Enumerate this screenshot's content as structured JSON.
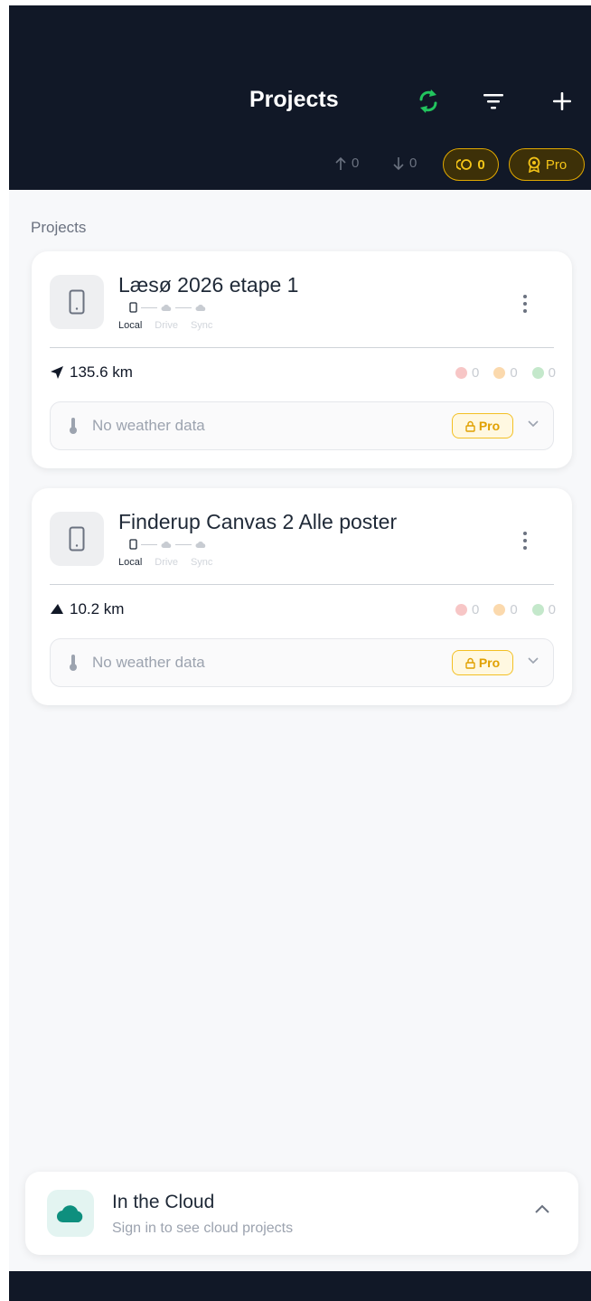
{
  "header": {
    "title": "Projects",
    "upload_count": "0",
    "download_count": "0",
    "points_count": "0",
    "pro_label": "Pro",
    "icons": [
      "sync-icon",
      "filter-icon",
      "plus-icon",
      "arrow-up-icon",
      "arrow-down-icon",
      "points-icon",
      "award-icon"
    ]
  },
  "section_label": "Projects",
  "projects": [
    {
      "name": "Læsø 2026 etape 1",
      "pipeline": [
        "Local",
        "Drive",
        "Sync"
      ],
      "distance": "135.6 km",
      "distance_icon": "navigation-arrow-icon",
      "red_count": "0",
      "orange_count": "0",
      "green_count": "0",
      "weather_text": "No weather data",
      "pro_label": "Pro"
    },
    {
      "name": "Finderup Canvas 2 Alle poster",
      "pipeline": [
        "Local",
        "Drive",
        "Sync"
      ],
      "distance": "10.2 km",
      "distance_icon": "triangle-icon",
      "red_count": "0",
      "orange_count": "0",
      "green_count": "0",
      "weather_text": "No weather data",
      "pro_label": "Pro"
    }
  ],
  "cloud": {
    "title": "In the Cloud",
    "subtitle": "Sign in to see cloud projects"
  },
  "colors": {
    "header_bg": "#111827",
    "sync_green": "#22c55e",
    "pro_gold": "#f5c518",
    "cloud_teal": "#0e8f7e"
  }
}
